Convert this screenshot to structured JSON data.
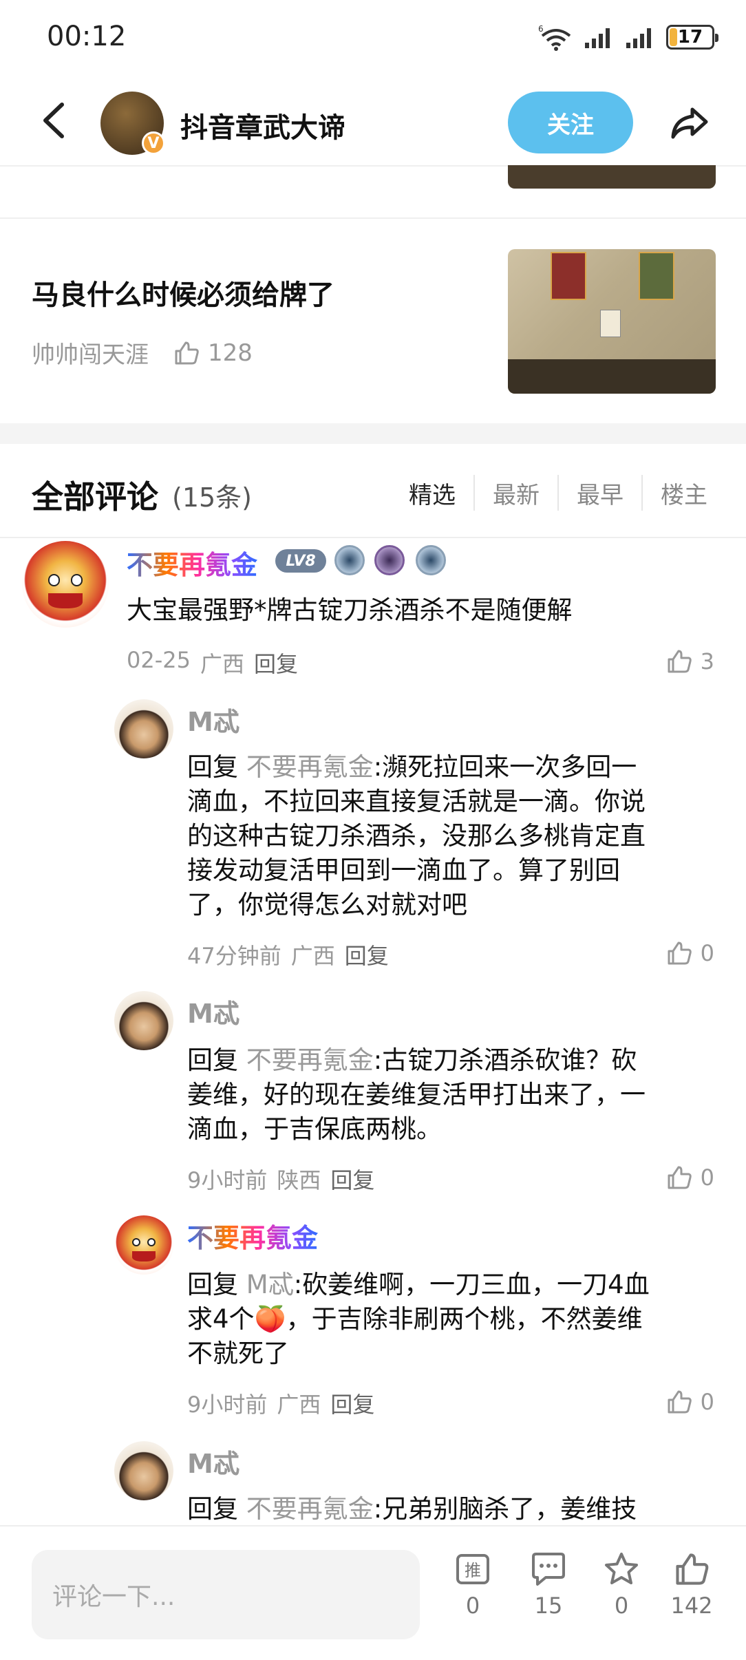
{
  "status_bar": {
    "time": "00:12",
    "network": "6",
    "battery": "17",
    "battery_level": 0.17
  },
  "header": {
    "name": "抖音章武大谛",
    "follow_label": "关注",
    "verified_badge": "V"
  },
  "article": {
    "title": "马良什么时候必须给牌了",
    "author": "帅帅闯天涯",
    "likes": "128"
  },
  "comments_section": {
    "title": "全部评论",
    "count": "(15条)",
    "sort_tabs": [
      "精选",
      "最新",
      "最早",
      "楼主"
    ]
  },
  "comments": [
    {
      "author": "不要再氪金",
      "level": "LV8",
      "text": "大宝最强野*牌古锭刀杀酒杀不是随便解",
      "date": "02-25",
      "location": "广西",
      "reply_label": "回复",
      "likes": "3"
    },
    {
      "author": "M忒",
      "reply_prefix": "回复",
      "mention": "不要再氪金",
      "lines": [
        "瀕死拉回来一次多回一",
        "滴血，不拉回来直接复活就是一滴。你说",
        "的这种古锭刀杀酒杀，没那么多桃肯定直",
        "接发动复活甲回到一滴血了。算了别回",
        "了，你觉得怎么对就对吧"
      ],
      "date": "47分钟前",
      "location": "广西",
      "reply_label": "回复",
      "likes": "0"
    },
    {
      "author": "M忒",
      "reply_prefix": "回复",
      "mention": "不要再氪金",
      "lines": [
        "古锭刀杀酒杀砍谁？砍",
        "姜维，好的现在姜维复活甲打出来了，一",
        "滴血，于吉保底两桃。"
      ],
      "date": "9小时前",
      "location": "陕西",
      "reply_label": "回复",
      "likes": "0"
    },
    {
      "author": "不要再氪金",
      "reply_prefix": "回复",
      "mention": "M忒",
      "lines": [
        "砍姜维啊，一刀三血，一刀4血",
        "求4个🍑，于吉除非刷两个桃，不然姜维",
        "不就死了"
      ],
      "date": "9小时前",
      "location": "广西",
      "reply_label": "回复",
      "likes": "0"
    },
    {
      "author": "M忒",
      "reply_prefix": "回复",
      "mention": "不要再氪金",
      "lines": [
        "兄弟别脑杀了，姜维技"
      ]
    }
  ],
  "bottom_bar": {
    "input_placeholder": "评论一下...",
    "recommend_count": "0",
    "comment_count": "15",
    "favorite_count": "0",
    "like_count": "142"
  },
  "colors": {
    "accent": "#5cc0ee",
    "mention": "#999999",
    "badge": "#6f8199"
  }
}
